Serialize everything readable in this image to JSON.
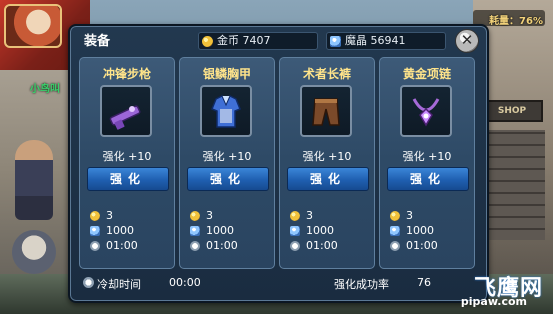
{
  "hud": {
    "player_name": "小鸟叫",
    "hp_text": "耗量：76%"
  },
  "panel": {
    "title": "装备",
    "gold": "7407",
    "crystal": "56941",
    "close_label": "✕"
  },
  "cards": [
    {
      "name": "冲锋步枪",
      "level": "强化 +10",
      "button": "强化",
      "gold_cost": "3",
      "crystal_cost": "1000",
      "time": "01:00",
      "icon": "rifle-icon",
      "color": "#9b66d8"
    },
    {
      "name": "银鳞胸甲",
      "level": "强化 +10",
      "button": "强化",
      "gold_cost": "3",
      "crystal_cost": "1000",
      "time": "01:00",
      "icon": "armor-icon",
      "color": "#3f6fd6"
    },
    {
      "name": "术者长裤",
      "level": "强化 +10",
      "button": "强化",
      "gold_cost": "3",
      "crystal_cost": "1000",
      "time": "01:00",
      "icon": "pants-icon",
      "color": "#7b4a2a"
    },
    {
      "name": "黄金项链",
      "level": "强化 +10",
      "button": "强化",
      "gold_cost": "3",
      "crystal_cost": "1000",
      "time": "01:00",
      "icon": "necklace-icon",
      "color": "#a66ad8"
    }
  ],
  "footer": {
    "cooldown_label": "冷却时间",
    "cooldown_value": "00:00",
    "success_label": "强化成功率",
    "success_value": "76"
  },
  "watermark": {
    "big": "飞鹰网",
    "small": "pipaw.com"
  },
  "background": {
    "shop_sign": "SHOP"
  }
}
